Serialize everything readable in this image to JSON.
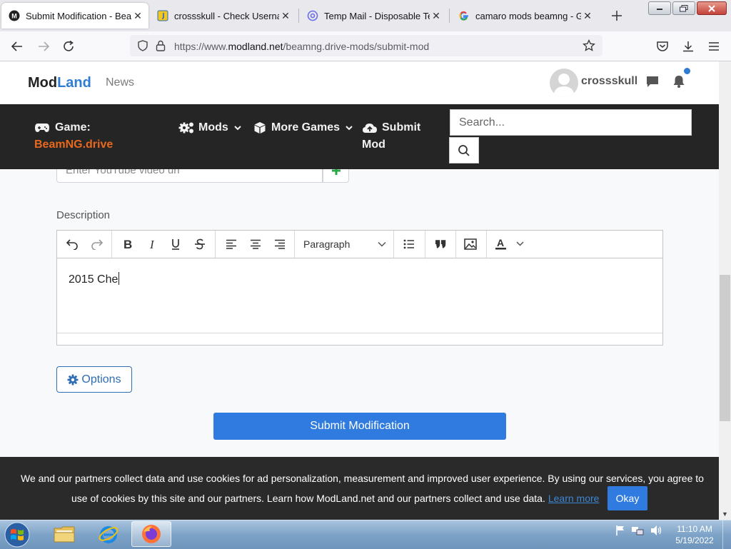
{
  "browser": {
    "tabs": [
      {
        "title": "Submit Modification - BeamNG",
        "active": true,
        "favicon": "modland-m-icon"
      },
      {
        "title": "crossskull - Check Usernames",
        "active": false,
        "favicon": "document-yellow-icon"
      },
      {
        "title": "Temp Mail - Disposable Temporary",
        "active": false,
        "favicon": "at-sign-icon"
      },
      {
        "title": "camaro mods beamng - Google",
        "active": false,
        "favicon": "google-g-icon"
      }
    ],
    "url_prefix": "https://www.",
    "url_domain": "modland.net",
    "url_path": "/beamng.drive-mods/submit-mod"
  },
  "site": {
    "logo_mod": "Mod",
    "logo_land": "Land",
    "nav_news": "News",
    "username": "crossskull",
    "game_label": "Game:",
    "game_value": "BeamNG.drive",
    "mods_label": "Mods",
    "more_games_label": "More Games",
    "submit_label_1": "Submit",
    "submit_label_2": "Mod",
    "search_placeholder": "Search..."
  },
  "form": {
    "youtube_placeholder": "Enter YouTube video url",
    "description_label": "Description",
    "heading_select": "Paragraph",
    "editor_text": "2015 Che",
    "options_label": "Options",
    "submit_label": "Submit Modification"
  },
  "cookie": {
    "line1": "We and our partners collect data and use cookies for ad personalization, measurement and improved user experience. By using our services, you agree to",
    "line2": "use of cookies by this site and our partners. Learn how ModLand.net and our partners collect and use data.",
    "learn_more": "Learn more",
    "okay": "Okay"
  },
  "taskbar": {
    "time": "11:10 AM",
    "date": "5/19/2022"
  },
  "colors": {
    "brand_blue": "#2f7dd1",
    "game_orange": "#e8681e",
    "nav_dark": "#252525",
    "primary_button": "#2f7be0"
  }
}
